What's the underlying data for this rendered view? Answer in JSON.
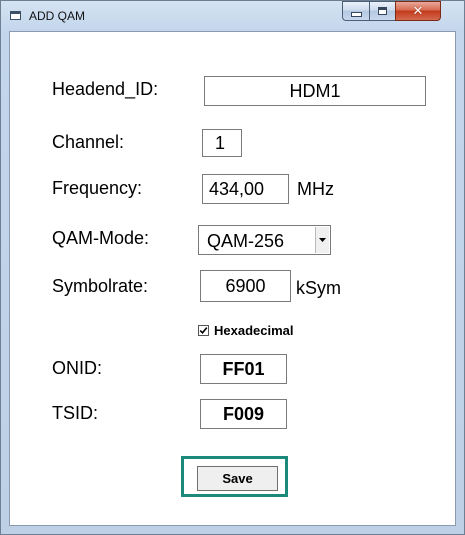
{
  "window": {
    "title": "ADD QAM"
  },
  "form": {
    "headend_label": "Headend_ID:",
    "headend_value": "HDM1",
    "channel_label": "Channel:",
    "channel_value": "1",
    "frequency_label": "Frequency:",
    "frequency_value": "434,00",
    "frequency_unit": "MHz",
    "qam_label": "QAM-Mode:",
    "qam_value": "QAM-256",
    "symbolrate_label": "Symbolrate:",
    "symbolrate_value": "6900",
    "symbolrate_unit": "kSym",
    "hex_label": "Hexadecimal",
    "hex_checked": true,
    "onid_label": "ONID:",
    "onid_value": "FF01",
    "tsid_label": "TSID:",
    "tsid_value": "F009",
    "save_label": "Save"
  },
  "icons": {
    "app": "window-icon",
    "minimize": "minimize-icon",
    "maximize": "maximize-icon",
    "close": "close-icon",
    "dropdown": "chevron-down-icon",
    "check": "checkmark-icon"
  },
  "colors": {
    "focus": "#1b8a7a",
    "close_button": "#c2391c"
  }
}
